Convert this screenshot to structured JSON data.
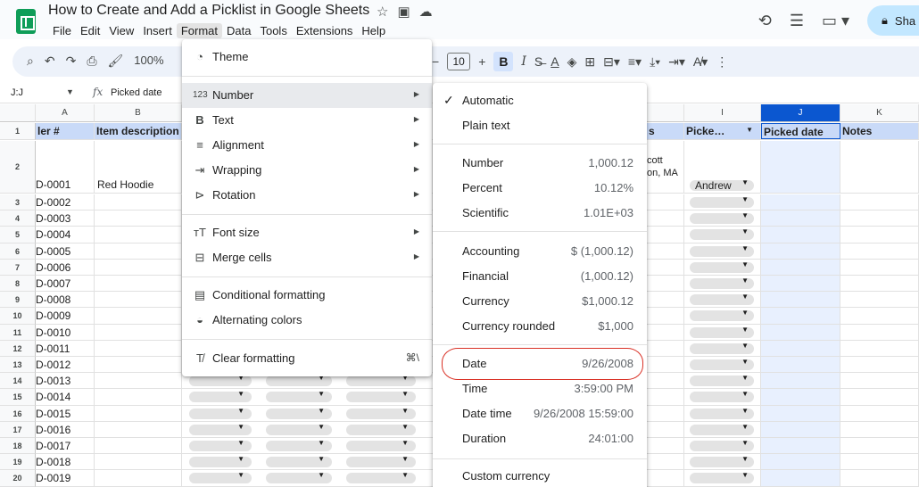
{
  "app": {
    "title": "How to Create and Add a Picklist in Google Sheets",
    "share_label": "Sha"
  },
  "menubar": [
    "File",
    "Edit",
    "View",
    "Insert",
    "Format",
    "Data",
    "Tools",
    "Extensions",
    "Help"
  ],
  "toolbar": {
    "zoom": "100%",
    "font_size": "10",
    "bold": "B",
    "italic": "I"
  },
  "formula_bar": {
    "name_box": "J:J",
    "fx": "fx",
    "content": "Picked date"
  },
  "columns": [
    "A",
    "B",
    "I",
    "J",
    "K"
  ],
  "header_cells": {
    "A": "ler #",
    "B": "Item description",
    "H_partial": "s",
    "I": "Picke…",
    "J": "Picked date",
    "K": "Notes"
  },
  "row2": {
    "A": "D-0001",
    "B": "Red Hoodie",
    "H_partial_line1": "cott",
    "H_partial_line2": "on, MA",
    "I": "Andrew"
  },
  "rows": [
    {
      "num": "3",
      "id": "D-0002"
    },
    {
      "num": "4",
      "id": "D-0003"
    },
    {
      "num": "5",
      "id": "D-0004"
    },
    {
      "num": "6",
      "id": "D-0005"
    },
    {
      "num": "7",
      "id": "D-0006"
    },
    {
      "num": "8",
      "id": "D-0007"
    },
    {
      "num": "9",
      "id": "D-0008"
    },
    {
      "num": "10",
      "id": "D-0009"
    },
    {
      "num": "11",
      "id": "D-0010"
    },
    {
      "num": "12",
      "id": "D-0011"
    },
    {
      "num": "13",
      "id": "D-0012"
    },
    {
      "num": "14",
      "id": "D-0013"
    },
    {
      "num": "15",
      "id": "D-0014"
    },
    {
      "num": "16",
      "id": "D-0015"
    },
    {
      "num": "17",
      "id": "D-0016"
    },
    {
      "num": "18",
      "id": "D-0017"
    },
    {
      "num": "19",
      "id": "D-0018"
    },
    {
      "num": "20",
      "id": "D-0019"
    }
  ],
  "row_numbers": {
    "header": "1",
    "row2": "2"
  },
  "format_menu": {
    "theme": "Theme",
    "number": "Number",
    "text": "Text",
    "alignment": "Alignment",
    "wrapping": "Wrapping",
    "rotation": "Rotation",
    "font_size": "Font size",
    "merge_cells": "Merge cells",
    "conditional": "Conditional formatting",
    "alternating": "Alternating colors",
    "clear": "Clear formatting",
    "clear_shortcut": "⌘\\"
  },
  "number_menu": {
    "automatic": "Automatic",
    "plain_text": "Plain text",
    "items": [
      {
        "label": "Number",
        "example": "1,000.12"
      },
      {
        "label": "Percent",
        "example": "10.12%"
      },
      {
        "label": "Scientific",
        "example": "1.01E+03"
      },
      {
        "label": "Accounting",
        "example": "$ (1,000.12)"
      },
      {
        "label": "Financial",
        "example": "(1,000.12)"
      },
      {
        "label": "Currency",
        "example": "$1,000.12"
      },
      {
        "label": "Currency rounded",
        "example": "$1,000"
      },
      {
        "label": "Date",
        "example": "9/26/2008"
      },
      {
        "label": "Time",
        "example": "3:59:00 PM"
      },
      {
        "label": "Date time",
        "example": "9/26/2008 15:59:00"
      },
      {
        "label": "Duration",
        "example": "24:01:00"
      }
    ],
    "custom_currency": "Custom currency"
  },
  "colors": {
    "accent": "#0b57d0",
    "header_fill": "#c9daf8",
    "highlight_circle": "#d93025",
    "share": "#c2e7ff"
  }
}
